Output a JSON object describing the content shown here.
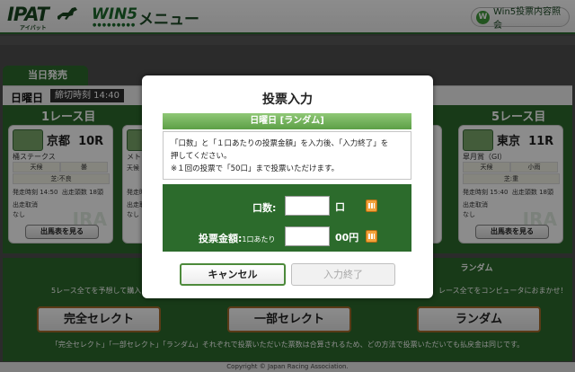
{
  "header": {
    "logo_ipat": "IPAT",
    "logo_ipat_sub": "アイパット",
    "logo_win5": "WIN5",
    "title": "メニュー",
    "win5_info_button": "Win5投票内容照会"
  },
  "panel": {
    "tab_label": "当日発売",
    "day_label": "日曜日",
    "deadline": "締切時刻 14:40"
  },
  "legs": [
    {
      "number_label": "1レース目",
      "venue": "京都",
      "race": "10R",
      "race_name": "桶ステークス",
      "weather": "天候",
      "weather_value": "曇",
      "track": "芝:不良",
      "start": "発走時刻 14:50",
      "runners": "出走頭数 18頭",
      "scratch_label": "出走取消",
      "scratch_value": "なし",
      "entry_button": "出馬表を見る"
    },
    {
      "number_label": "5レース目",
      "venue": "東京",
      "race": "11R",
      "race_name": "皐月賞（GI）",
      "weather": "天候",
      "weather_value": "小雨",
      "track": "芝:重",
      "start": "発走時刻 15:40",
      "runners": "出走頭数 18頭",
      "scratch_label": "出走取消",
      "scratch_value": "なし",
      "entry_button": "出馬表を見る"
    }
  ],
  "partial_card": {
    "race_name": "メトロ",
    "weather": "天候",
    "start": "発走時",
    "scratch_label": "出走取",
    "scratch_value": "なし",
    "venue_fragment": "R"
  },
  "bottom": {
    "random_header": "ランダム",
    "desc_left": "5レース全てを予想して購入！",
    "desc_right": "レース全てをコンピュータにおまかせ！",
    "btn_full_select": "完全セレクト",
    "btn_partial_select": "一部セレクト",
    "btn_random": "ランダム",
    "note": "「完全セレクト」「一部セレクト」「ランダム」それぞれで投票いただいた票数は合算されるため、どの方法で投票いただいても払戻金は同じです。",
    "copyright": "Copyright © Japan Racing Association."
  },
  "modal": {
    "title": "投票入力",
    "section_header": "日曜日 [ランダム]",
    "instruction_line1": "「口数」と「１口あたりの投票金額」を入力後、「入力終了」を",
    "instruction_line2": "押してください。",
    "instruction_line3": "※１回の投票で「50口」まで投票いただけます。",
    "count_label": "口数:",
    "count_value": "",
    "count_unit": "口",
    "amount_label": "投票金額:",
    "amount_sublabel": "1口あたり",
    "amount_value": "",
    "amount_unit": "00円",
    "cancel_button": "キャンセル",
    "finish_button": "入力終了"
  },
  "colors": {
    "brand_green": "#2c6b2c",
    "header_green": "#5c9f46",
    "button_border": "#a56b2b"
  }
}
